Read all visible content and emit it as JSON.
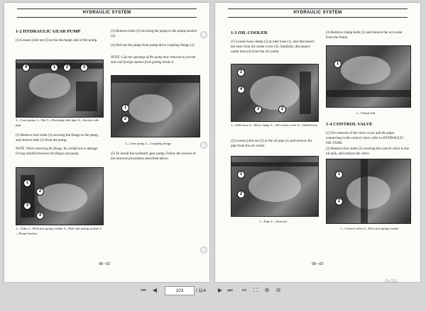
{
  "toolbar": {
    "first_icon": "first-page-icon",
    "prev_icon": "previous-page-icon",
    "current_page": "103",
    "separator_total": "/ 114",
    "next_icon": "next-page-icon",
    "last_icon": "last-page-icon",
    "fit_icon": "fit-width-icon",
    "fullscreen_icon": "fullscreen-icon",
    "zoom_in_icon": "zoom-in-icon",
    "zoom_out_icon": "zoom-out-icon"
  },
  "watermark": "Activ...",
  "left_page": {
    "header": "HYDRAULIC SYSTEM",
    "section_title": "1-2 HYDRAULIC GEAR PUMP",
    "step1": "(1)  Loosen joint nut (2) at the discharge side of the pump.",
    "fig1_caption": "1—Gear pump  2—Nut  3—Discharge side pipe  4—Suction side pipe",
    "step2": "(2)  Remove four bolts (3) securing the flange to the pump, and remove tube (1) from the pump.",
    "note1": "NOTE:  When removing the flange, be careful not to damage O-ring installed between the flange and pump.",
    "fig2_caption": "1—Tube  2—Bolt and spring washer  3—Bolt and spring washer  4—Pump bracket",
    "step3": "(3)  Remove bolts (3) securing the pump to the pump bracket (4).",
    "step4": "(4)  Pull out the pump from pump drive coupling flange (2).",
    "note2": "NOTE:  Cap the openings of the pump thus removed to prevent dust and foreign matters from getting inside it.",
    "fig3_caption": "1—Gear pump  2—Coupling flange",
    "step5": "(5)  To install the hydraulic gear pump, follow the reverse of the removal procedures described above.",
    "page_number": "08—02"
  },
  "right_page": {
    "header": "HYDRAULIC SYSTEM",
    "section_title": "1-3 OIL COOLER",
    "step1": "(1)  Loosen hose clamp (2) at inlet hose (1), and disconnect the hose from oil cooler cover (3). Similarly, disconnect outlet hose (4) from the oil cooler.",
    "fig1_caption": "1—Inlet hose  2—Hose clamp  3—Oil cooler cover  4—Outlet hose",
    "step2": "(2)  Loosen joint nut (2) at the oil pipe (1) and remove the pipe from the oil cooler.",
    "fig2_caption": "1—Pipe  2—Joint nut",
    "step3": "(3)  Remove clamp bolts (1) and remove the oil cooler from the frame.",
    "fig3_caption": "1—Clamp bolt",
    "section2_title": "1-4 CONTROL VALVE",
    "s2_step1": "(1)  For removal of the valve cover and the pipes connecting to the control valve, refer to HYDRAULIC OIL TANK.",
    "s2_step2": "(2)  Remove four bolts (2) securing the control valve to the oil tank, and remove the valve.",
    "fig4_caption": "1—Control valve  2—Bolt and spring washer",
    "page_number": "08—03"
  }
}
